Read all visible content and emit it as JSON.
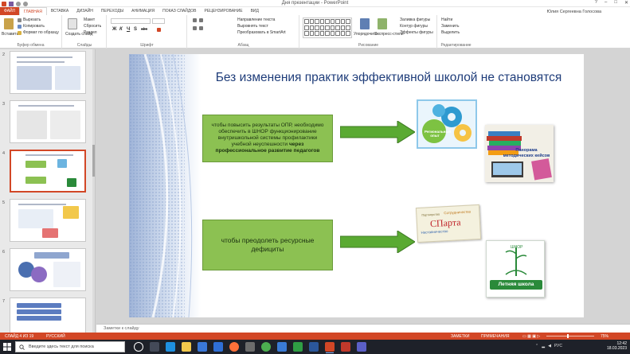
{
  "window": {
    "title": "Дня презентации - PowerPoint",
    "user": "Юлия Сергеевна Голосова",
    "controls": [
      "?",
      "–",
      "□",
      "✕"
    ]
  },
  "ribbon_tabs": [
    "ФАЙЛ",
    "ГЛАВНАЯ",
    "ВСТАВКА",
    "ДИЗАЙН",
    "ПЕРЕХОДЫ",
    "АНИМАЦИЯ",
    "ПОКАЗ СЛАЙДОВ",
    "РЕЦЕНЗИРОВАНИЕ",
    "ВИД"
  ],
  "ribbon": {
    "clipboard": {
      "paste": "Вставить",
      "cut": "Вырезать",
      "copy": "Копировать",
      "format": "Формат по образцу",
      "label": "Буфер обмена"
    },
    "slides": {
      "create": "Создать слайд",
      "layout": "Макет",
      "reset": "Сбросить",
      "section": "Раздел",
      "label": "Слайды"
    },
    "font": {
      "name": "",
      "size": "",
      "label": "Шрифт",
      "bold": "Ж",
      "italic": "К",
      "underline": "Ч",
      "strike": "S",
      "shadow": "abc"
    },
    "paragraph": {
      "direction": "Направление текста",
      "align": "Выровнять текст",
      "smartart": "Преобразовать в SmartArt",
      "label": "Абзац"
    },
    "drawing": {
      "arrange": "Упорядочить",
      "styles": "Экспресс-стили",
      "fill": "Заливка фигуры",
      "outline": "Контур фигуры",
      "effects": "Эффекты фигуры",
      "label": "Рисование"
    },
    "editing": {
      "find": "Найти",
      "replace": "Заменить",
      "select": "Выделить",
      "label": "Редактирование"
    }
  },
  "thumbnails": [
    {
      "num": "2"
    },
    {
      "num": "3"
    },
    {
      "num": "4",
      "selected": true
    },
    {
      "num": "5"
    },
    {
      "num": "6"
    },
    {
      "num": "7"
    }
  ],
  "slide": {
    "title": "Без изменения практик эффективной школой не становятся",
    "box1_text": "чтобы повысить результаты ОПР, необходимо обеспечить в ШНОР функционирование внутришкольной системы профилактики учебной неуспешности ",
    "box1_bold": "через профессиональное развитие педагогов",
    "box2_text": "чтобы преодолеть ресурсные дефициты",
    "gears_label": "Региональный опыт",
    "books_label": "Панорама методических кейсов",
    "sparta_main": "СПарта",
    "sparta_top": "Сотрудничество",
    "sparta_left": "Наставничество",
    "sparta_small": "Партнерство",
    "school_label": "Летняя школа"
  },
  "notes": {
    "placeholder": "Заметки к слайду"
  },
  "statusbar": {
    "slide_info": "СЛАЙД 4 ИЗ 19",
    "language": "РУССКИЙ",
    "notes_btn": "ЗАМЕТКИ",
    "comments_btn": "ПРИМЕЧАНИЯ",
    "zoom": "75%",
    "accent": "#d24726"
  },
  "taskbar": {
    "search_placeholder": "Введите здесь текст для поиска",
    "time": "12:42",
    "date": "18.03.2023",
    "lang": "РУС"
  }
}
